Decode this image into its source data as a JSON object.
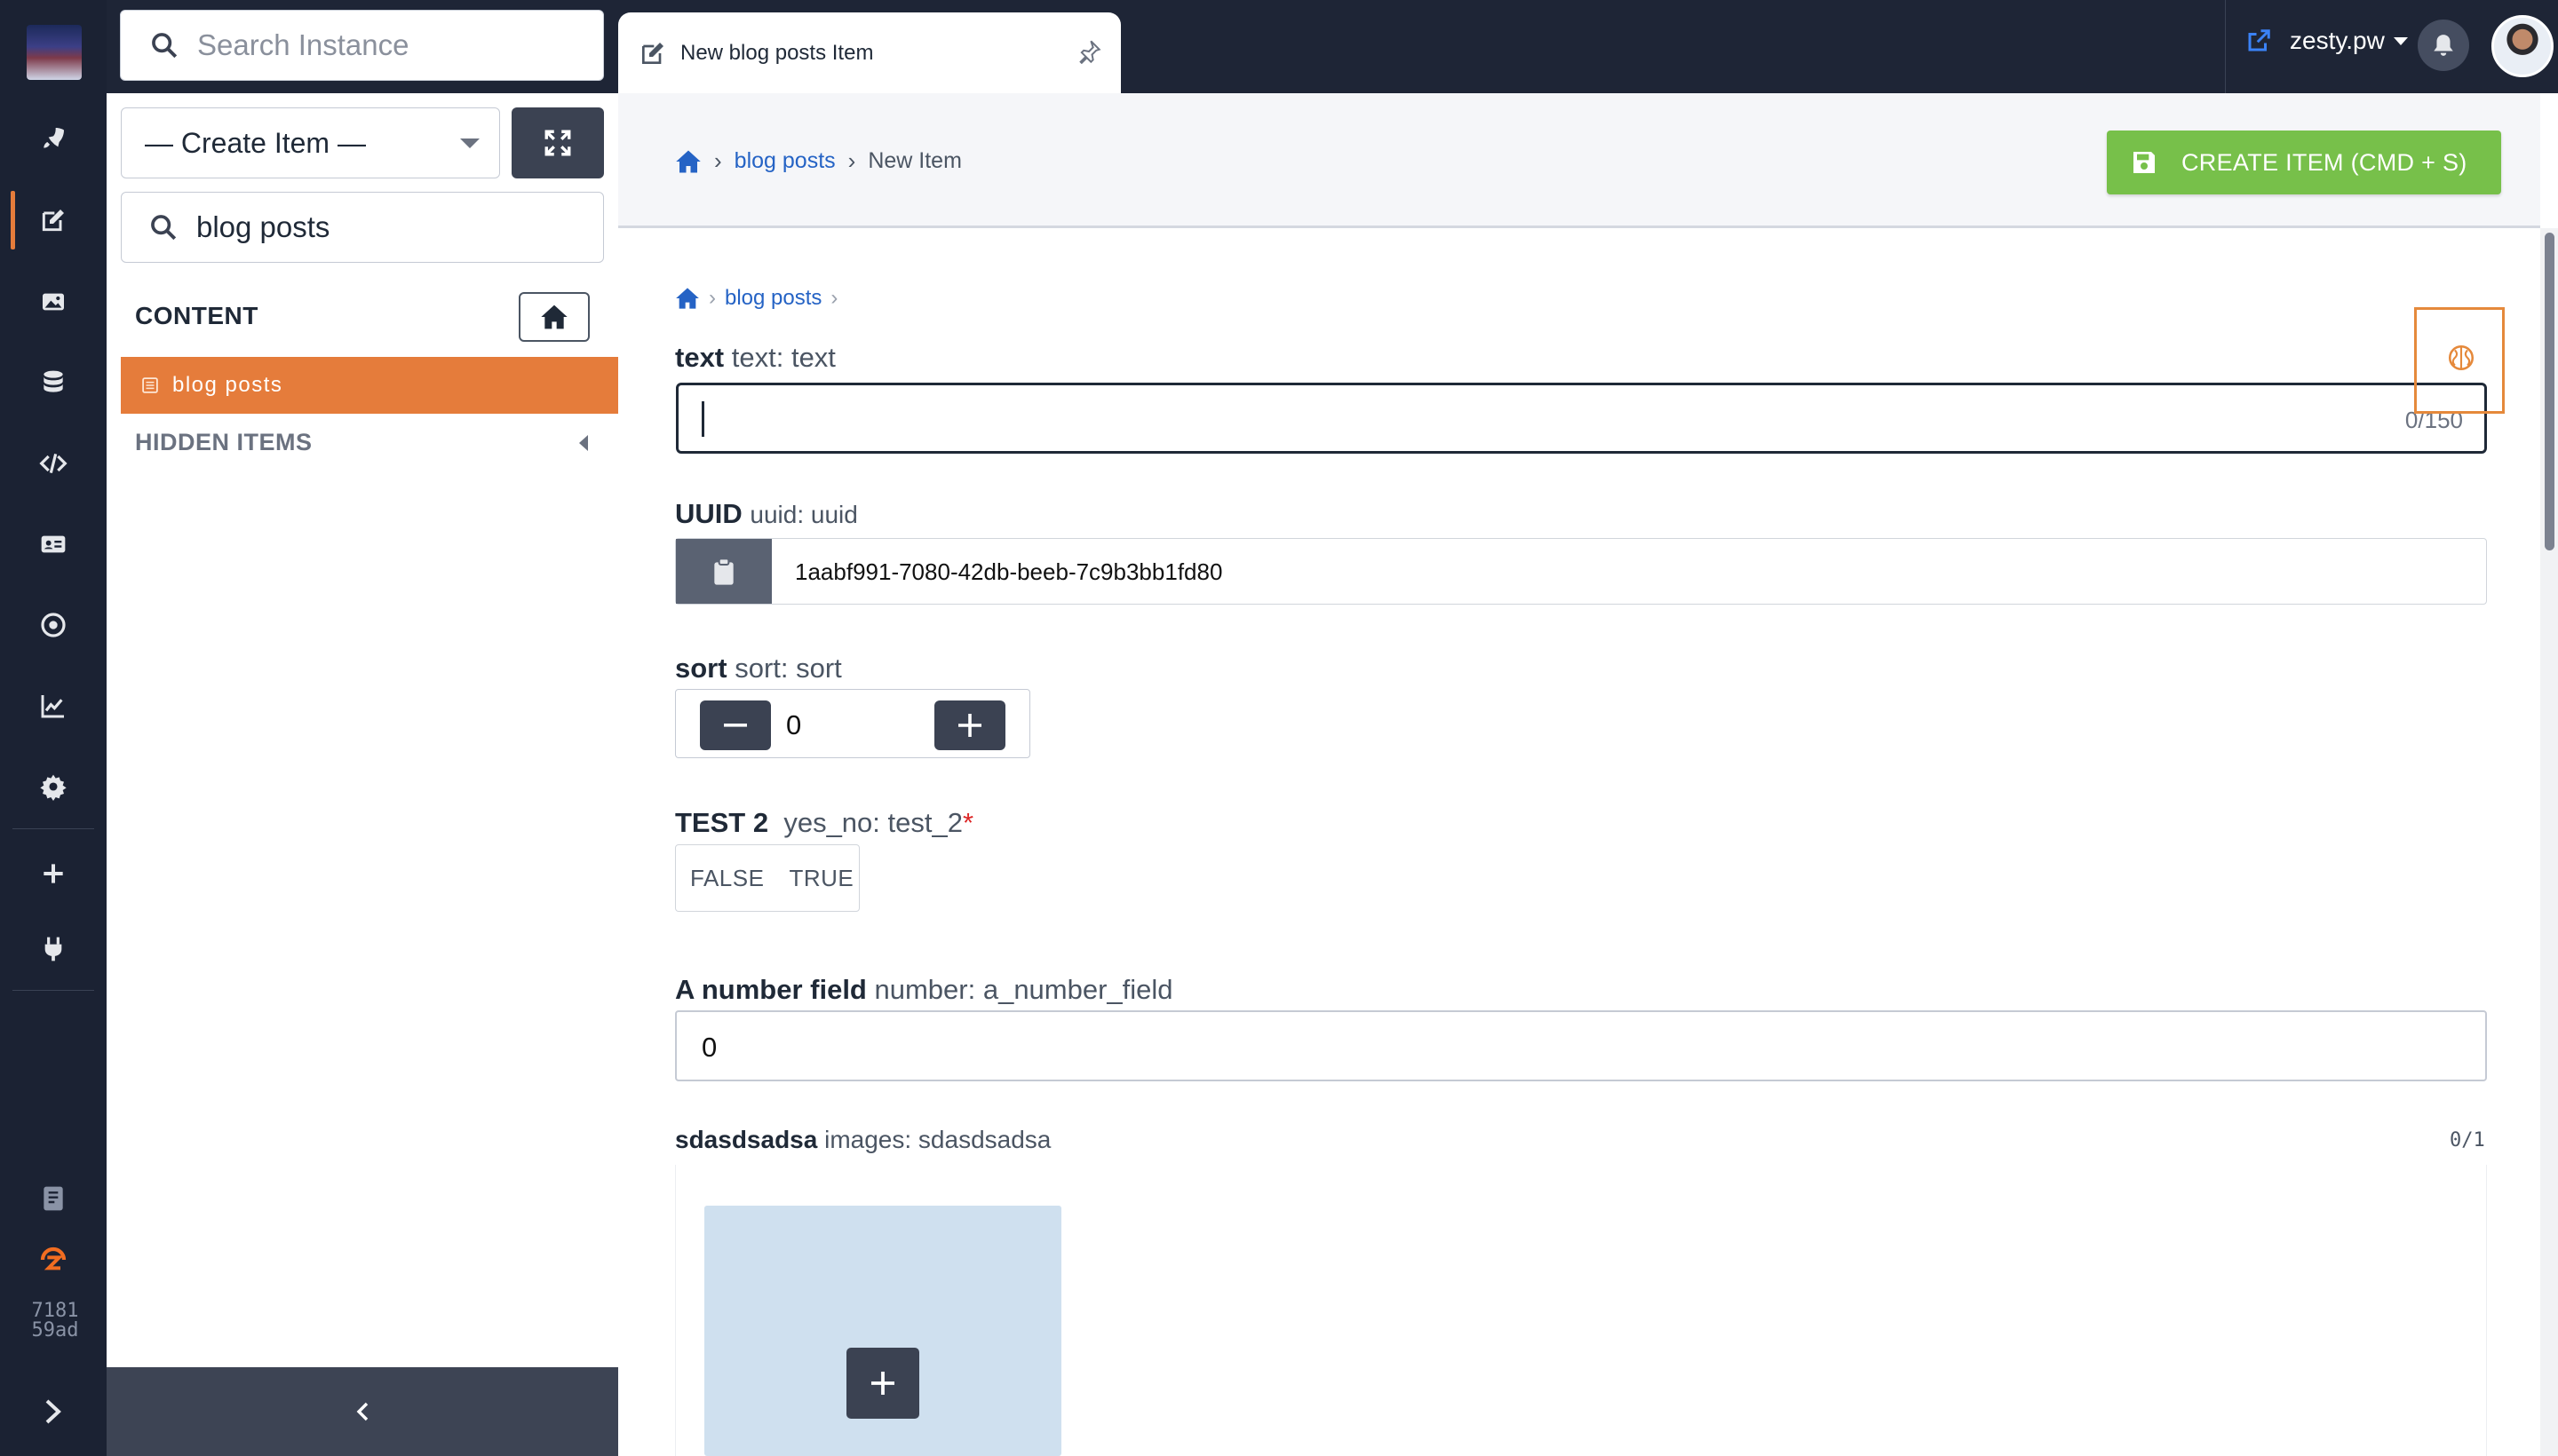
{
  "topbar": {
    "instance_search_placeholder": "Search Instance",
    "tab_title": "New blog posts Item",
    "site_name": "zesty.pw"
  },
  "rail": {
    "items": [
      "launch-icon",
      "content-icon",
      "media-icon",
      "schema-icon",
      "code-icon",
      "leads-icon",
      "seo-icon",
      "reports-icon",
      "settings-icon",
      "add-icon",
      "apps-icon"
    ],
    "active_item": "content-icon",
    "bottom_items": [
      "docs-icon",
      "zesty-logo-icon"
    ],
    "version_line1": "7181",
    "version_line2": "59ad",
    "accent_color": "#e57c3b"
  },
  "sidebar": {
    "create_select_value": "— Create Item —",
    "filter_value": "blog posts",
    "content_heading": "CONTENT",
    "nav_items": [
      {
        "label": "blog posts",
        "active": true
      }
    ],
    "hidden_heading": "HIDDEN ITEMS"
  },
  "header": {
    "breadcrumb_link": "blog posts",
    "breadcrumb_current": "New Item",
    "create_button_label": "CREATE ITEM  (CMD + S)",
    "create_button_color": "#77c04a"
  },
  "form": {
    "breadcrumb_link": "blog posts",
    "fields": {
      "text": {
        "label": "text",
        "meta": "text: text",
        "value": "",
        "counter": "0/150"
      },
      "uuid": {
        "label": "UUID",
        "meta": "uuid: uuid",
        "value": "1aabf991-7080-42db-beeb-7c9b3bb1fd80"
      },
      "sort": {
        "label": "sort",
        "meta": "sort: sort",
        "value": "0"
      },
      "test2": {
        "label": "TEST 2",
        "meta": "yes_no: test_2",
        "required_mark": "*",
        "false_label": "FALSE",
        "true_label": "TRUE"
      },
      "number": {
        "label": "A number field",
        "meta": "number: a_number_field",
        "value": "0"
      },
      "images": {
        "label": "sdasdsadsa",
        "meta": "images: sdasdsadsa",
        "counter": "0/1"
      }
    }
  }
}
